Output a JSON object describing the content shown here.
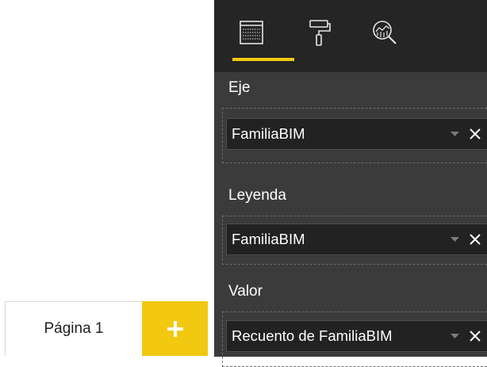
{
  "page_tabs": {
    "pages": [
      "Página 1"
    ],
    "add_icon": "plus-icon",
    "accent_color": "#f2c811"
  },
  "visualizations_pane": {
    "tabs": [
      {
        "icon": "fields-icon",
        "active": true
      },
      {
        "icon": "format-paint-roller-icon",
        "active": false
      },
      {
        "icon": "analytics-magnifier-icon",
        "active": false
      }
    ],
    "wells": [
      {
        "label": "Eje",
        "field": "FamiliaBIM"
      },
      {
        "label": "Leyenda",
        "field": "FamiliaBIM"
      },
      {
        "label": "Valor",
        "field": "Recuento de FamiliaBIM"
      }
    ],
    "pane_background": "#3b3b3b",
    "toolbar_background": "#252525"
  }
}
